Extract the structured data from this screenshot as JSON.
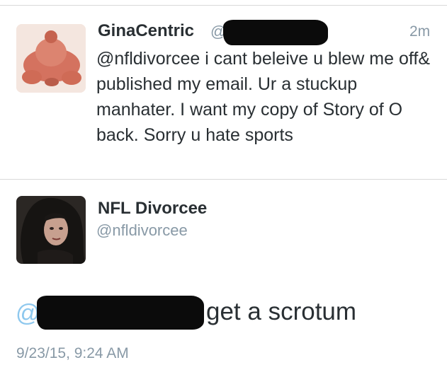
{
  "tweet1": {
    "author_name": "GinaCentric",
    "handle_prefix": "@",
    "time_ago": "2m",
    "text": "@nfldivorcee i cant beleive u blew me off& published my email. Ur a stuckup manhater. I want my copy of Story of O back. Sorry u hate sports"
  },
  "tweet2": {
    "author_name": "NFL Divorcee",
    "handle": "@nfldivorcee",
    "reply_at": "@",
    "reply_text": "get a scrotum",
    "timestamp": "9/23/15, 9:24 AM"
  },
  "colors": {
    "text": "#292f33",
    "secondary": "#8899a6",
    "mention_blue": "#8ec8ee",
    "divider": "#d8d8d8",
    "redaction": "#0b0b0b"
  }
}
